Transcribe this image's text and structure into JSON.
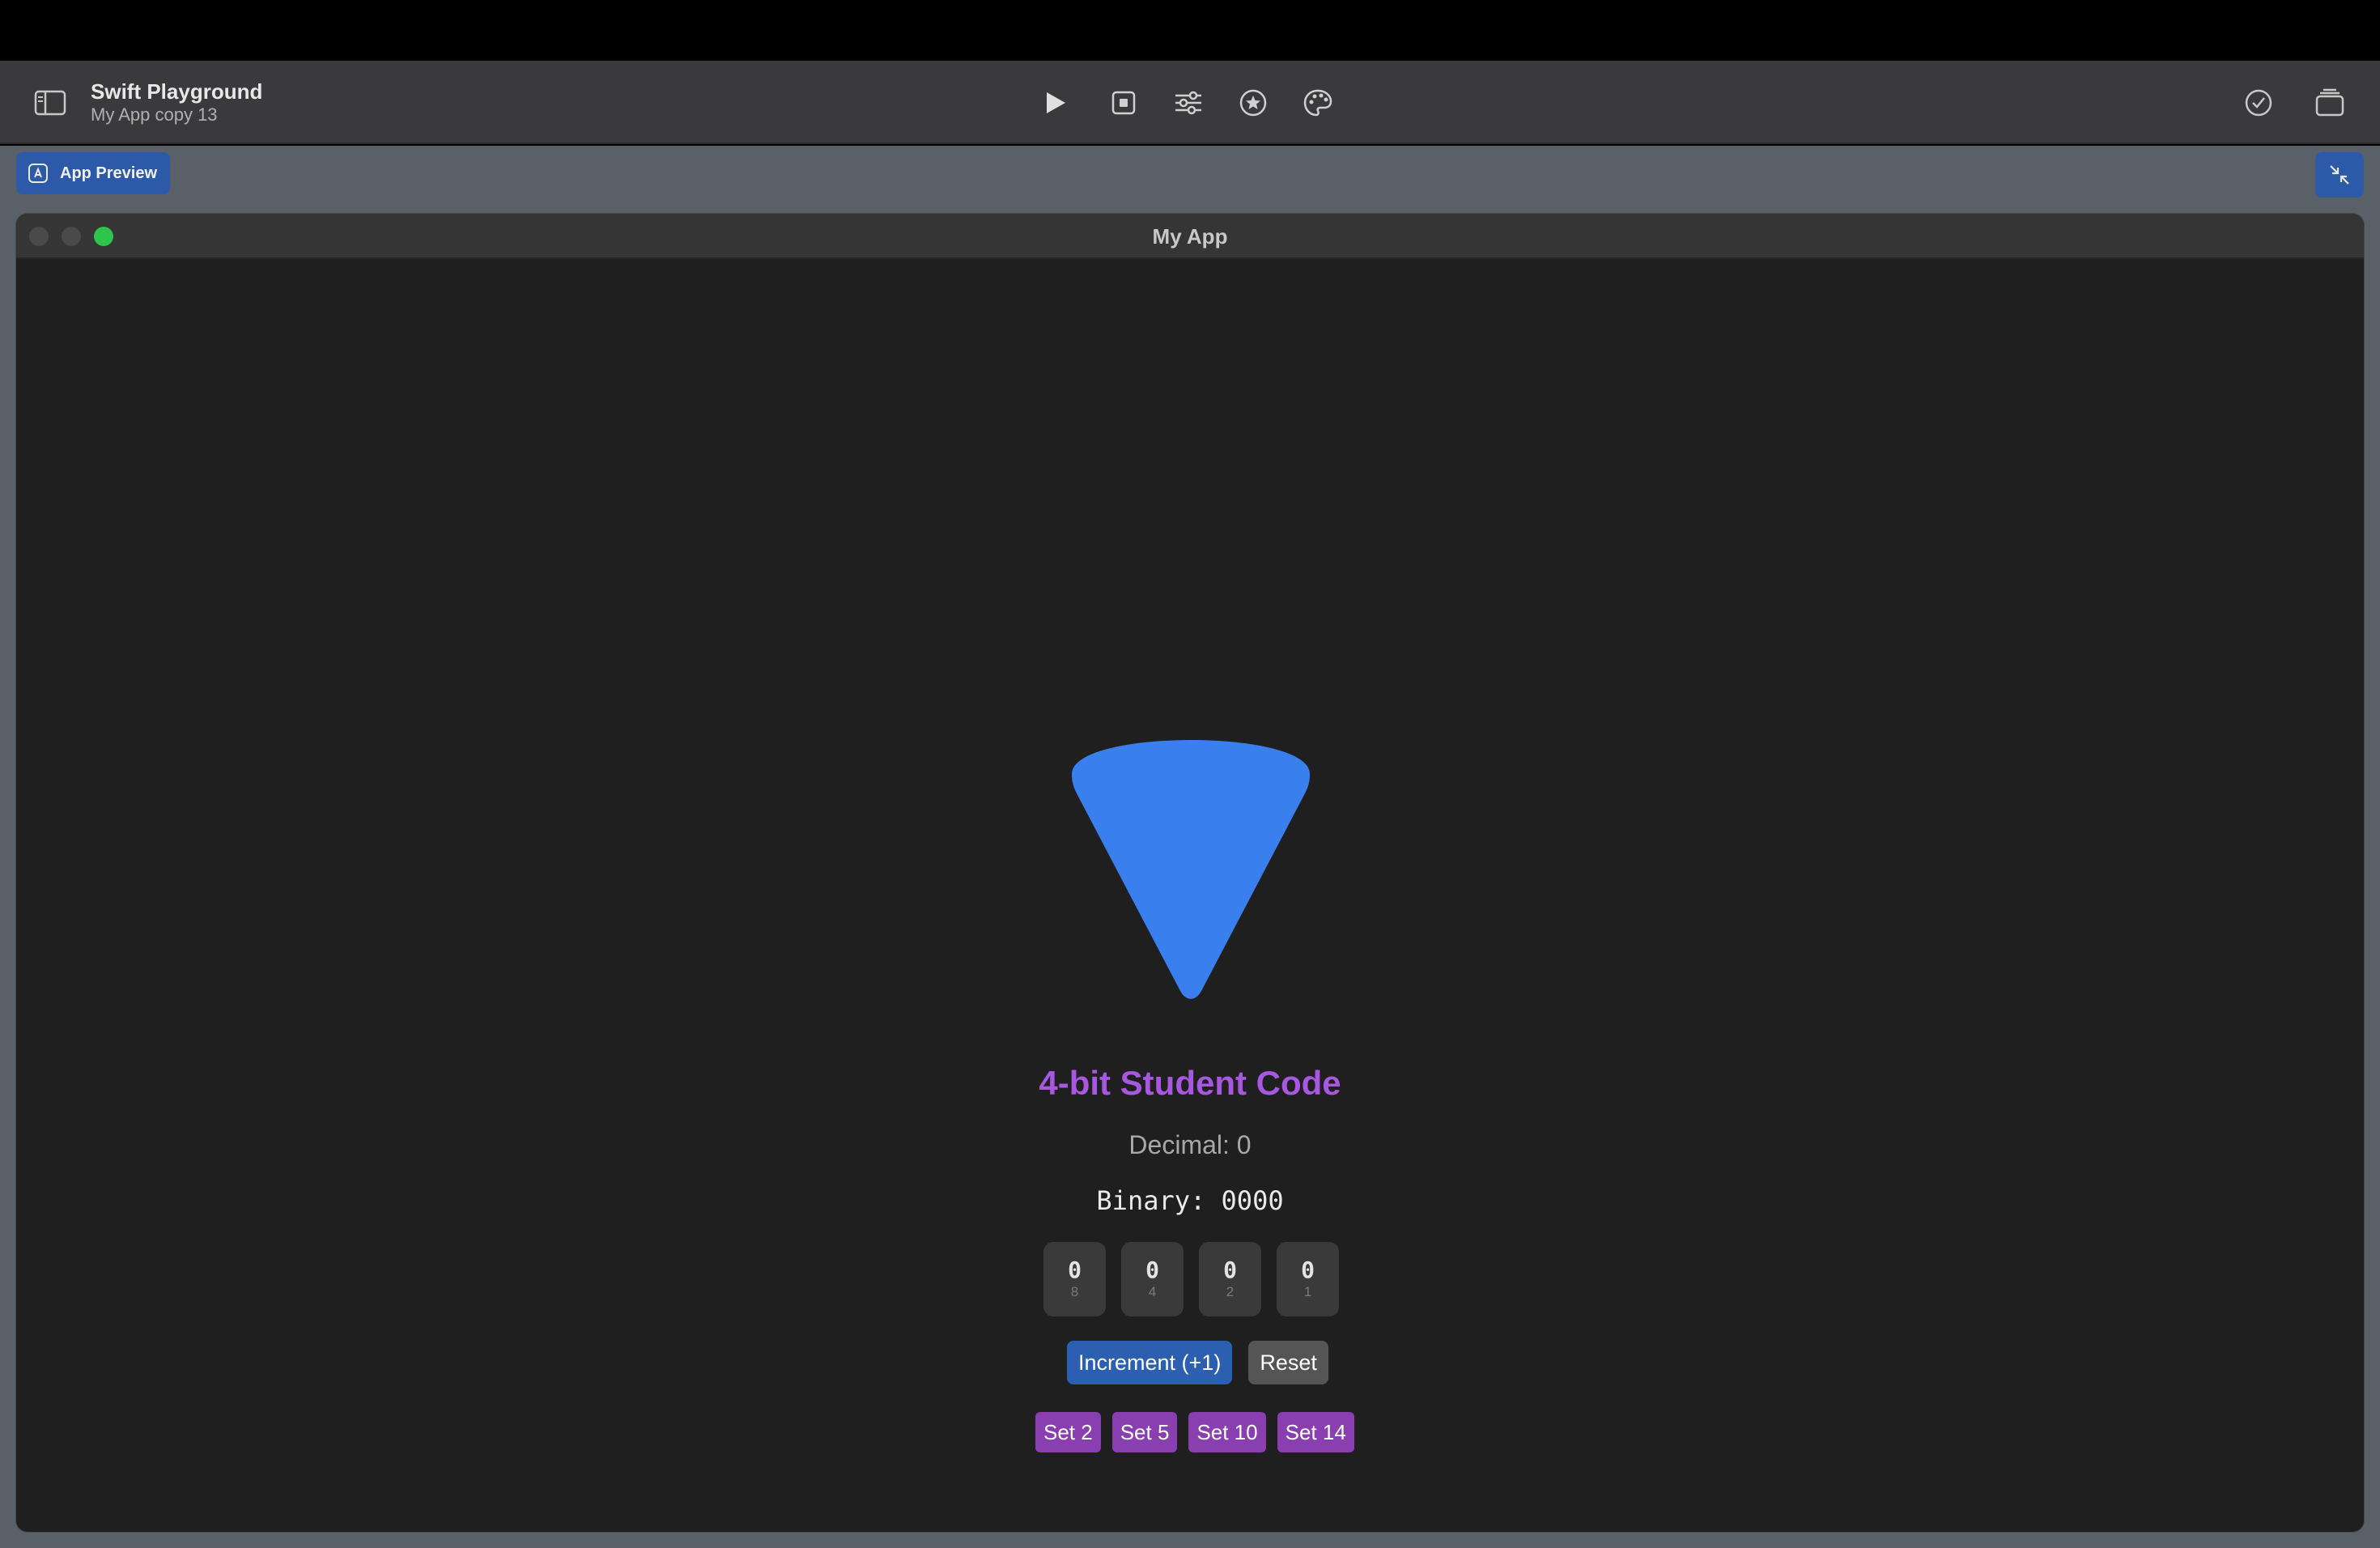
{
  "toolbar": {
    "app_name": "Swift Playground",
    "project_name": "My App copy 13",
    "icons": [
      "sidebar-icon",
      "play-icon",
      "stop-icon",
      "sliders-icon",
      "star-icon",
      "palette-icon",
      "checkmark-icon",
      "windows-icon"
    ]
  },
  "preview": {
    "button_label": "App Preview"
  },
  "app": {
    "window_title": "My App",
    "heading": "4-bit Student Code",
    "decimal_text": "Decimal: 0",
    "binary_text": "Binary: 0000",
    "bits": [
      {
        "value": "0",
        "weight": "8"
      },
      {
        "value": "0",
        "weight": "4"
      },
      {
        "value": "0",
        "weight": "2"
      },
      {
        "value": "0",
        "weight": "1"
      }
    ],
    "increment_label": "Increment (+1)",
    "reset_label": "Reset",
    "set_buttons": [
      "Set 2",
      "Set 5",
      "Set 10",
      "Set 14"
    ]
  },
  "colors": {
    "accent_blue": "#3a7fee",
    "heading_purple": "#a757e0",
    "button_purple": "#8a3fb0"
  }
}
